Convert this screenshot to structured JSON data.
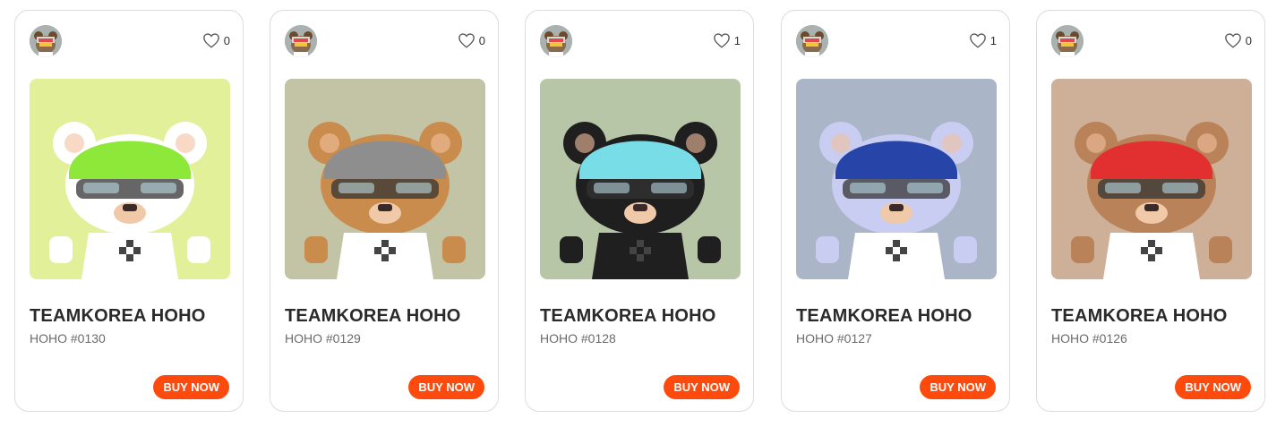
{
  "cards": [
    {
      "likes": "0",
      "title": "TEAMKOREA HOHO",
      "subtitle": "HOHO #0130",
      "buy_label": "BUY NOW",
      "art_bg": "#e2f09a",
      "bear_color": "#ffffff",
      "helmet_color": "#8ee83a"
    },
    {
      "likes": "0",
      "title": "TEAMKOREA HOHO",
      "subtitle": "HOHO #0129",
      "buy_label": "BUY NOW",
      "art_bg": "#c3c4a6",
      "bear_color": "#c98c4d",
      "helmet_color": "#8e8e8e"
    },
    {
      "likes": "1",
      "title": "TEAMKOREA HOHO",
      "subtitle": "HOHO #0128",
      "buy_label": "BUY NOW",
      "art_bg": "#b7c6a7",
      "bear_color": "#1f1f1f",
      "helmet_color": "#79dde8"
    },
    {
      "likes": "1",
      "title": "TEAMKOREA HOHO",
      "subtitle": "HOHO #0127",
      "buy_label": "BUY NOW",
      "art_bg": "#aab5c8",
      "bear_color": "#c9cdf2",
      "helmet_color": "#2744a8"
    },
    {
      "likes": "0",
      "title": "TEAMKOREA HOHO",
      "subtitle": "HOHO #0126",
      "buy_label": "BUY NOW",
      "art_bg": "#cdb097",
      "bear_color": "#b98258",
      "helmet_color": "#e23030"
    }
  ],
  "colors": {
    "accent": "#ff4a0e",
    "border": "#dcdcdc"
  },
  "icons": {
    "like": "heart-outline-icon",
    "avatar": "creator-avatar"
  }
}
